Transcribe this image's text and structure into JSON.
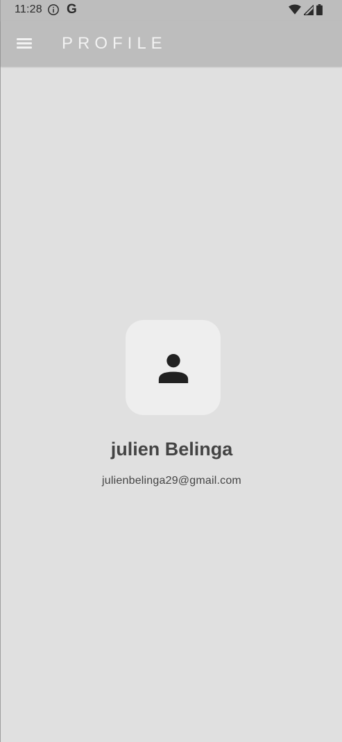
{
  "status_bar": {
    "time": "11:28",
    "g_label": "G",
    "icons": [
      "info-icon",
      "wifi-icon",
      "signal-icon",
      "battery-icon"
    ]
  },
  "app_bar": {
    "title": "PROFILE",
    "menu_icon": "hamburger-menu-icon"
  },
  "profile": {
    "avatar_icon": "person-icon",
    "name": "julien Belinga",
    "email": "julienbelinga29@gmail.com"
  },
  "colors": {
    "background": "#e0e0e0",
    "app_bar": "#bdbdbd",
    "avatar_bg": "#eeeeee",
    "text": "#444444"
  }
}
